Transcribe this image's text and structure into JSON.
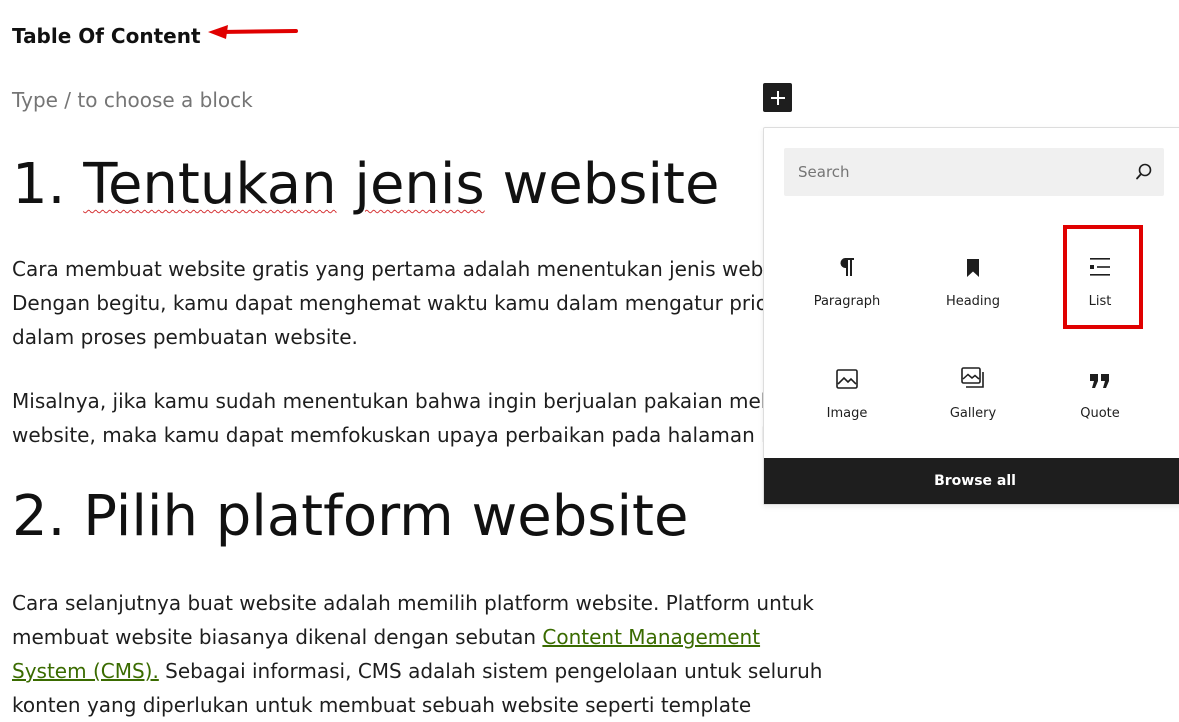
{
  "editor": {
    "toc_title": "Table Of Content",
    "placeholder": "Type / to choose a block",
    "heading1": {
      "number": "1.",
      "word1": "Tentukan",
      "word2": "jenis",
      "rest": "website"
    },
    "para1": [
      "Cara membuat website gratis yang pertama adalah menentukan jenis website.",
      "Dengan begitu, kamu dapat menghemat waktu kamu dalam mengatur prioritas",
      "dalam proses pembuatan website."
    ],
    "para2": [
      "Misalnya, jika kamu sudah menentukan bahwa ingin berjualan pakaian melalui",
      "website, maka kamu dapat memfokuskan upaya perbaikan pada halaman katalo"
    ],
    "heading2": "2. Pilih platform website",
    "para3": {
      "line1": "Cara selanjutnya buat website adalah memilih platform website. Platform untuk",
      "line2_pre": "membuat website biasanya dikenal dengan sebutan ",
      "link_part1": "Content Management ",
      "link_part2": "System (CMS).",
      "line3_post": " Sebagai informasi, CMS adalah sistem pengelolaan untuk seluruh",
      "line4": "konten yang diperlukan untuk membuat sebuah website seperti template"
    }
  },
  "inserter": {
    "search_placeholder": "Search",
    "blocks": [
      {
        "label": "Paragraph",
        "icon": "paragraph-icon"
      },
      {
        "label": "Heading",
        "icon": "bookmark-icon"
      },
      {
        "label": "List",
        "icon": "list-icon"
      },
      {
        "label": "Image",
        "icon": "image-icon"
      },
      {
        "label": "Gallery",
        "icon": "gallery-icon"
      },
      {
        "label": "Quote",
        "icon": "quote-icon"
      }
    ],
    "browse_all": "Browse all"
  },
  "colors": {
    "accent_red": "#e00000",
    "dark": "#1e1e1e",
    "link_green": "#3a6b00"
  }
}
